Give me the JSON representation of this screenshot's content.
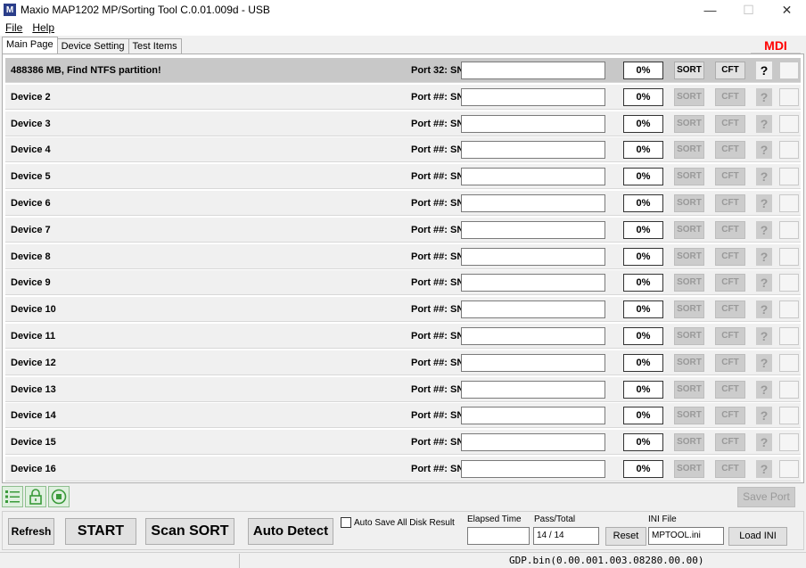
{
  "window": {
    "icon_letter": "M",
    "title": "Maxio MAP1202 MP/Sorting Tool C.0.01.009d - USB",
    "minimize": "—",
    "maximize": "☐",
    "close": "✕"
  },
  "menu": {
    "items": [
      "File",
      "Help"
    ]
  },
  "tabs": [
    "Main Page",
    "Device Setting",
    "Test Items"
  ],
  "mdi_label": "MDI",
  "rows": [
    {
      "name": "488386 MB, Find NTFS partition!",
      "port": "Port 32: SN",
      "percent": "0%",
      "sort": "SORT",
      "cft": "CFT",
      "help": "?"
    },
    {
      "name": "Device 2",
      "port": "Port ##: SN",
      "percent": "0%",
      "sort": "SORT",
      "cft": "CFT",
      "help": "?"
    },
    {
      "name": "Device 3",
      "port": "Port ##: SN",
      "percent": "0%",
      "sort": "SORT",
      "cft": "CFT",
      "help": "?"
    },
    {
      "name": "Device 4",
      "port": "Port ##: SN",
      "percent": "0%",
      "sort": "SORT",
      "cft": "CFT",
      "help": "?"
    },
    {
      "name": "Device 5",
      "port": "Port ##: SN",
      "percent": "0%",
      "sort": "SORT",
      "cft": "CFT",
      "help": "?"
    },
    {
      "name": "Device 6",
      "port": "Port ##: SN",
      "percent": "0%",
      "sort": "SORT",
      "cft": "CFT",
      "help": "?"
    },
    {
      "name": "Device 7",
      "port": "Port ##: SN",
      "percent": "0%",
      "sort": "SORT",
      "cft": "CFT",
      "help": "?"
    },
    {
      "name": "Device 8",
      "port": "Port ##: SN",
      "percent": "0%",
      "sort": "SORT",
      "cft": "CFT",
      "help": "?"
    },
    {
      "name": "Device 9",
      "port": "Port ##: SN",
      "percent": "0%",
      "sort": "SORT",
      "cft": "CFT",
      "help": "?"
    },
    {
      "name": "Device 10",
      "port": "Port ##: SN",
      "percent": "0%",
      "sort": "SORT",
      "cft": "CFT",
      "help": "?"
    },
    {
      "name": "Device 11",
      "port": "Port ##: SN",
      "percent": "0%",
      "sort": "SORT",
      "cft": "CFT",
      "help": "?"
    },
    {
      "name": "Device 12",
      "port": "Port ##: SN",
      "percent": "0%",
      "sort": "SORT",
      "cft": "CFT",
      "help": "?"
    },
    {
      "name": "Device 13",
      "port": "Port ##: SN",
      "percent": "0%",
      "sort": "SORT",
      "cft": "CFT",
      "help": "?"
    },
    {
      "name": "Device 14",
      "port": "Port ##: SN",
      "percent": "0%",
      "sort": "SORT",
      "cft": "CFT",
      "help": "?"
    },
    {
      "name": "Device 15",
      "port": "Port ##: SN",
      "percent": "0%",
      "sort": "SORT",
      "cft": "CFT",
      "help": "?"
    },
    {
      "name": "Device 16",
      "port": "Port ##: SN",
      "percent": "0%",
      "sort": "SORT",
      "cft": "CFT",
      "help": "?"
    }
  ],
  "toolbar_icons": [
    "list-icon",
    "lock-icon",
    "stop-icon"
  ],
  "save_port": "Save Port",
  "controls": {
    "refresh": "Refresh",
    "start": "START",
    "scan_sort": "Scan SORT",
    "auto_detect": "Auto Detect",
    "auto_save_label": "Auto Save All Disk Result",
    "elapsed_label": "Elapsed Time",
    "elapsed_value": "",
    "pass_total_label": "Pass/Total",
    "pass_total_value": "14 / 14",
    "reset": "Reset",
    "ini_label": "INI File",
    "ini_value": "MPTOOL.ini",
    "load_ini": "Load INI"
  },
  "statusbar": {
    "text": "GDP.bin(0.00.001.003.08280.00.00)"
  },
  "colors": {
    "mdi": "#ff0000",
    "first_row": "#c8c8c8",
    "row": "#f0f0f0",
    "disabled_button": "#cccccc"
  }
}
